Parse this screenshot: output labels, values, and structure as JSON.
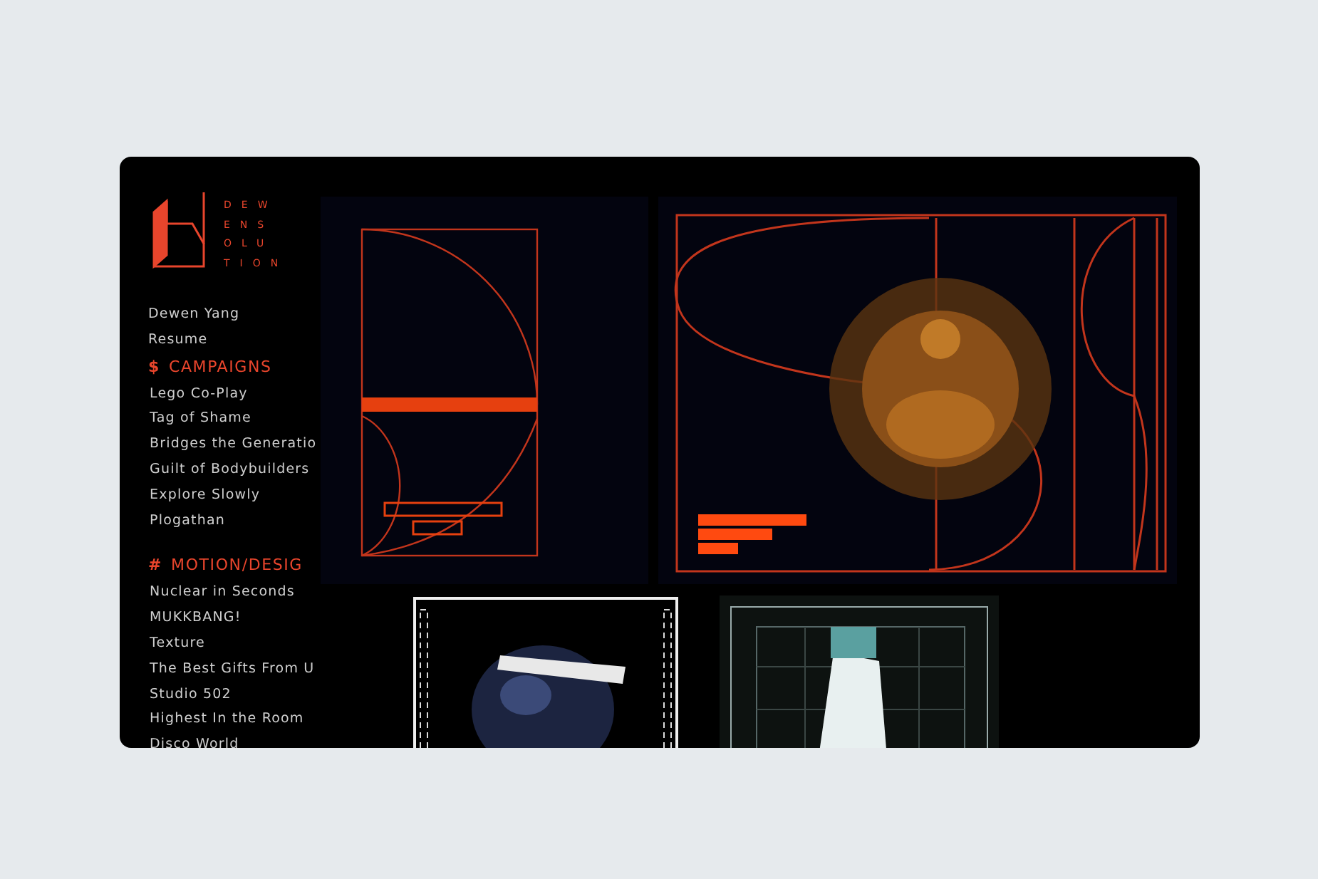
{
  "logo": {
    "letters": [
      "DEW",
      "ENS",
      "OLU",
      "TION"
    ]
  },
  "profile_links": [
    "Dewen Yang",
    "Resume"
  ],
  "sections": [
    {
      "marker": "$",
      "title": "CAMPAIGNS",
      "items": [
        "Lego Co-Play",
        "Tag of Shame",
        "Bridges the Generatio",
        "Guilt of Bodybuilders",
        "Explore Slowly",
        "Plogathan"
      ]
    },
    {
      "marker": "#",
      "title": "MOTION/DESIG",
      "items": [
        "Nuclear in Seconds",
        "MUKKBANG!",
        "Texture",
        "The Best Gifts From U",
        "Studio 502",
        "Highest In the Room",
        "Disco World"
      ]
    }
  ]
}
